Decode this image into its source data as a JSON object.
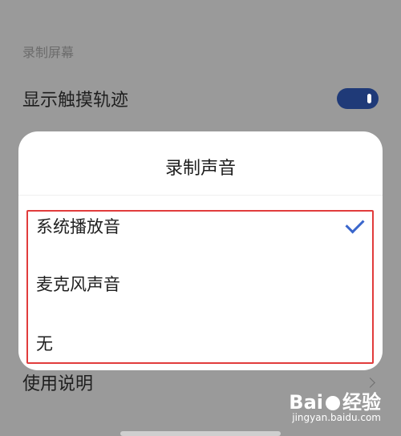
{
  "background_section": {
    "title": "录制屏幕",
    "touch_trail_label": "显示触摸轨迹",
    "help_label": "使用说明"
  },
  "dialog": {
    "title": "录制声音",
    "options": [
      {
        "label": "系统播放音",
        "selected": true
      },
      {
        "label": "麦克风声音",
        "selected": false
      },
      {
        "label": "无",
        "selected": false
      }
    ]
  },
  "icons": {
    "check": "check-icon",
    "chevron": "chevron-right-icon",
    "toggle_on": "toggle-on-icon"
  },
  "colors": {
    "accent": "#3a66cc",
    "highlight_border": "#e13c3c",
    "toggle_on": "#1f3a78"
  },
  "watermark": {
    "brand_prefix": "Bai",
    "brand_suffix": "经验",
    "url": "jingyan.baidu.com"
  }
}
